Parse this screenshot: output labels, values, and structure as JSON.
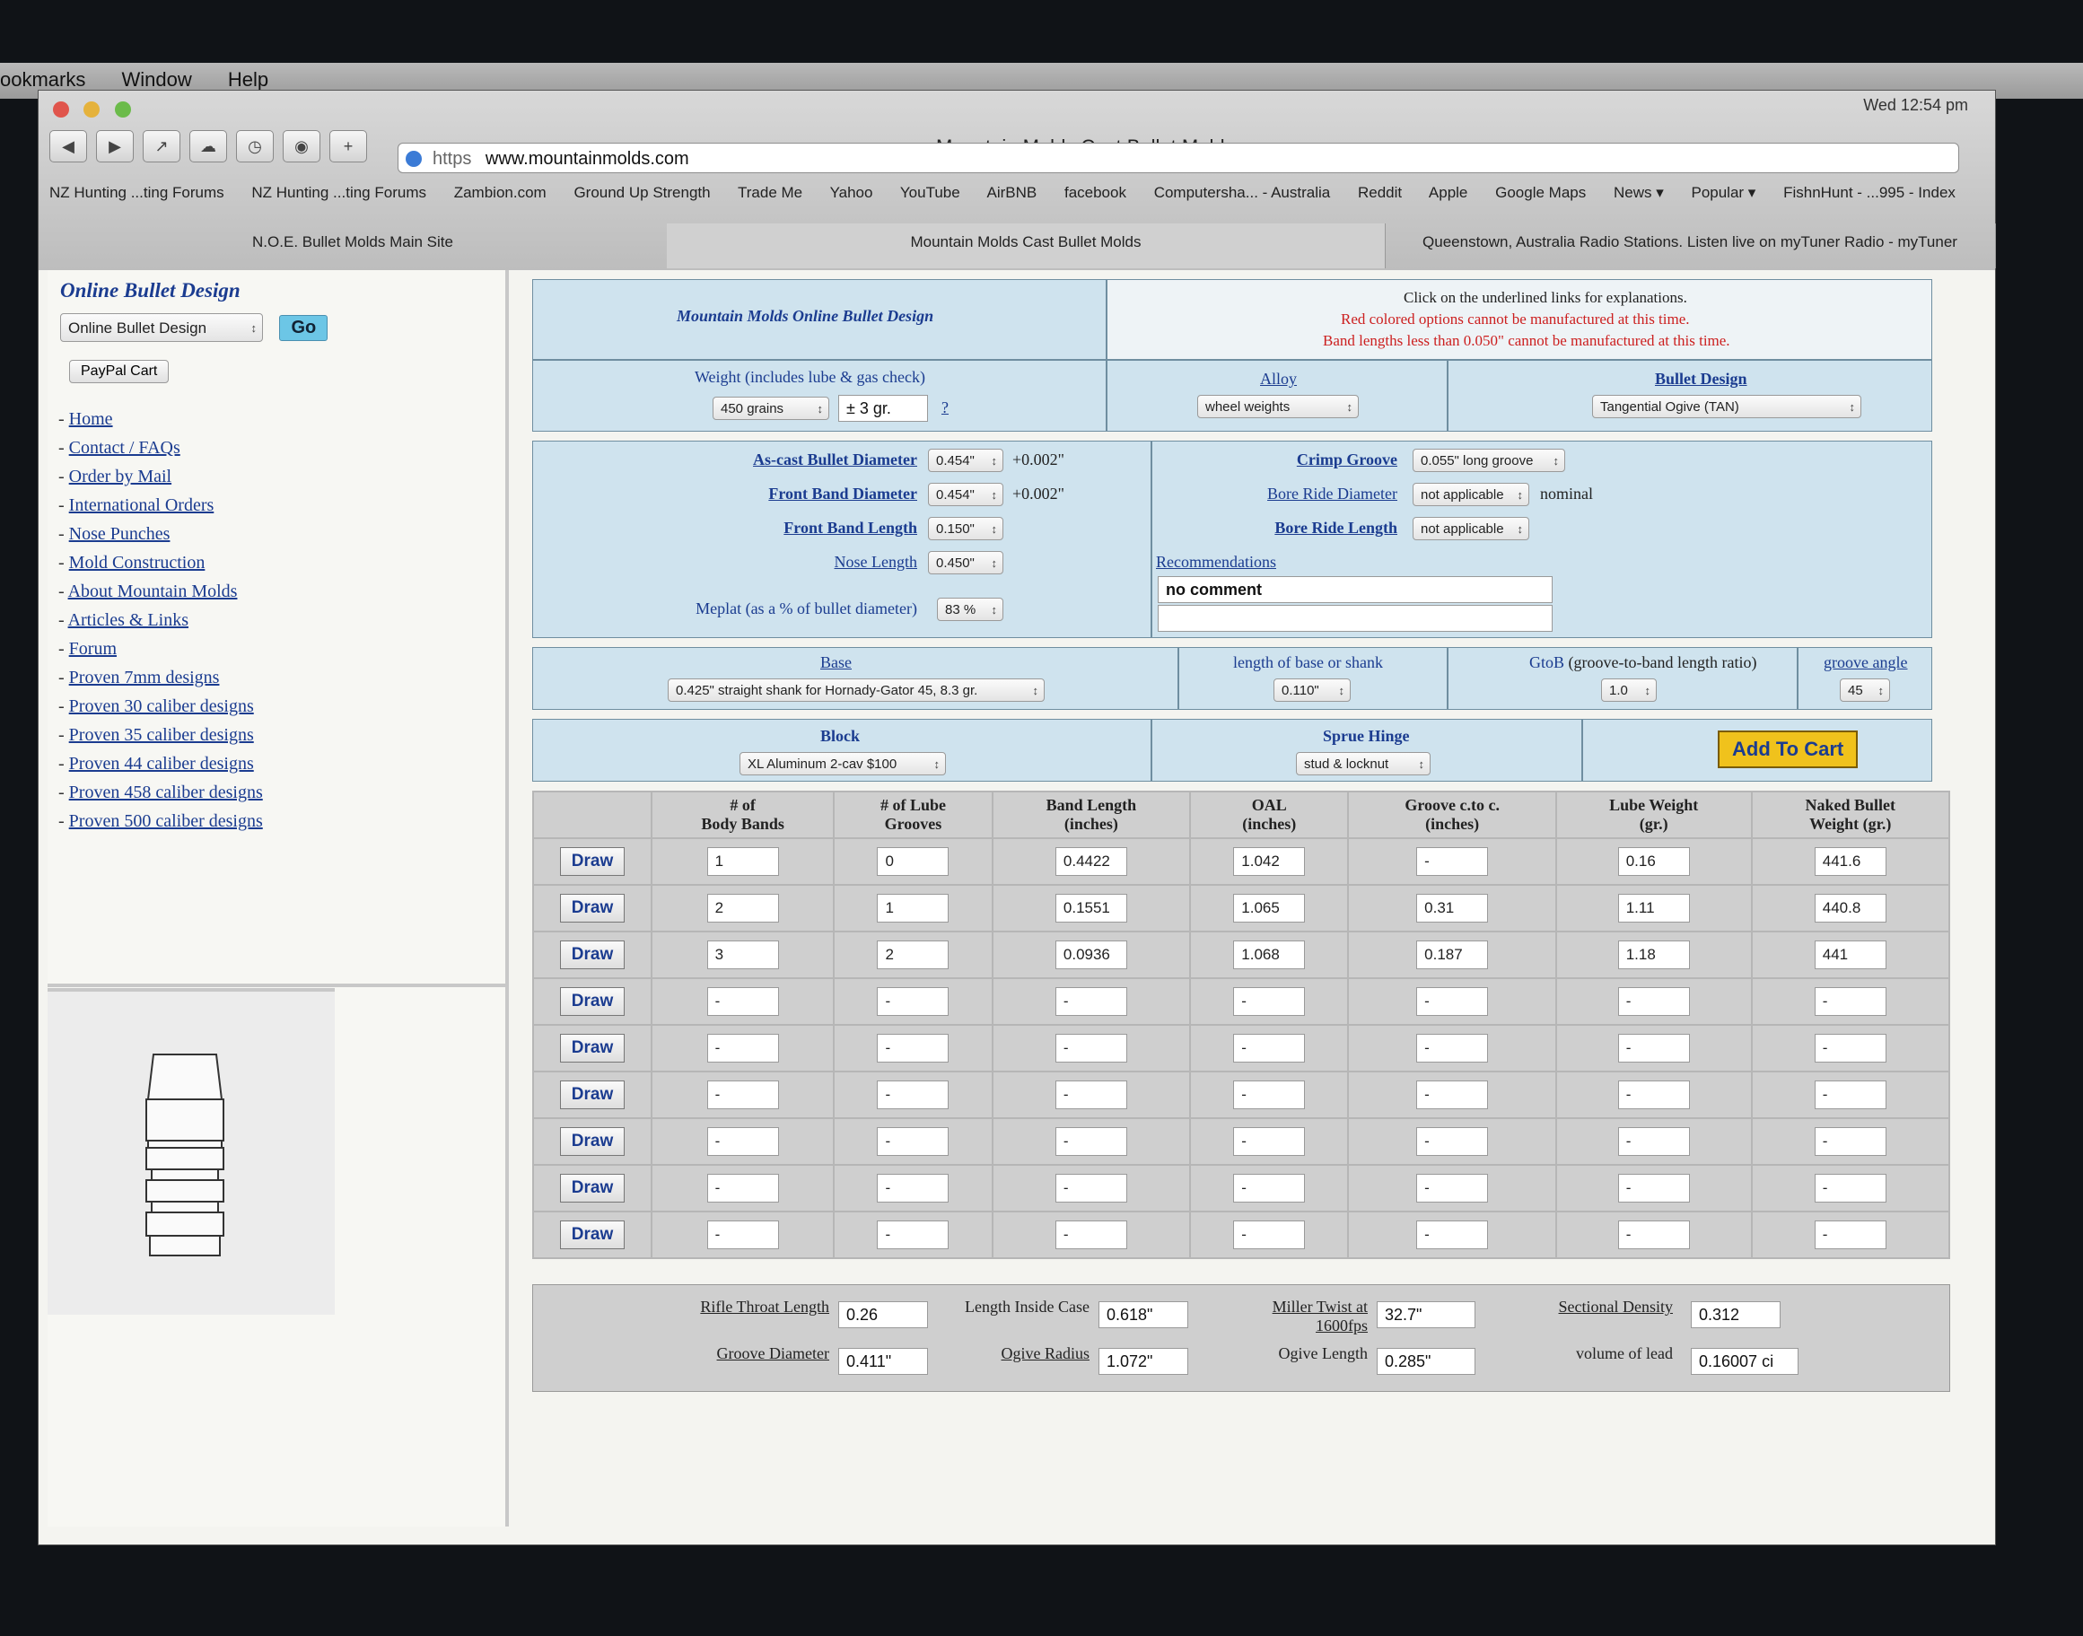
{
  "menubar": {
    "items": [
      "ookmarks",
      "Window",
      "Help"
    ],
    "clock": "Wed 12:54 pm"
  },
  "window": {
    "title": "Mountain Molds Cast Bullet Molds",
    "url_scheme": "https",
    "url": "www.mountainmolds.com",
    "bookmarks": [
      "NZ Hunting ...ting Forums",
      "NZ Hunting ...ting Forums",
      "Zambion.com",
      "Ground Up Strength",
      "Trade Me",
      "Yahoo",
      "YouTube",
      "AirBNB",
      "facebook",
      "Computersha... - Australia",
      "Reddit",
      "Apple",
      "Google Maps",
      "News ▾",
      "Popular ▾",
      "FishnHunt - ...995 - Index"
    ],
    "tabs": [
      "N.O.E. Bullet Molds Main Site",
      "Mountain Molds Cast Bullet Molds",
      "Queenstown, Australia Radio Stations. Listen live on myTuner Radio - myTuner"
    ]
  },
  "sidebar": {
    "title": "Online Bullet Design",
    "select": "Online Bullet Design",
    "go": "Go",
    "paypal": "PayPal Cart",
    "links": [
      "Home",
      "Contact / FAQs",
      "Order by Mail",
      "International Orders",
      "Nose Punches",
      "Mold Construction",
      "About Mountain Molds",
      "Articles & Links",
      "Forum",
      "Proven 7mm designs",
      "Proven 30 caliber designs",
      "Proven 35 caliber designs",
      "Proven 44 caliber designs",
      "Proven 458 caliber designs",
      "Proven 500 caliber designs"
    ]
  },
  "design": {
    "heading": "Mountain Molds Online Bullet Design",
    "info1": "Click on the underlined links for explanations.",
    "info2": "Red colored options cannot be manufactured at this time.",
    "info3": "Band lengths less than 0.050\" cannot be manufactured at this time.",
    "weight_label": "Weight",
    "weight_note": "(includes lube & gas check)",
    "weight": "450 grains",
    "weight_tol": "± 3 gr.",
    "q": "?",
    "alloy_label": "Alloy",
    "alloy": "wheel weights",
    "bullet_design_label": "Bullet Design",
    "bullet_design": "Tangential Ogive (TAN)",
    "ascast_label": "As-cast Bullet Diameter",
    "ascast": "0.454\"",
    "ascast_tol": "+0.002\"",
    "frontband_label": "Front Band Diameter",
    "frontband": "0.454\"",
    "frontband_tol": "+0.002\"",
    "frontlen_label": "Front Band Length",
    "frontlen": "0.150\"",
    "nose_label": "Nose Length",
    "nose": "0.450\"",
    "meplat_label": "Meplat",
    "meplat_note": "(as a % of bullet diameter)",
    "meplat": "83 %",
    "crimp_label": "Crimp Groove",
    "crimp": "0.055\" long groove",
    "boreride_label": "Bore Ride Diameter",
    "boreride": "not applicable",
    "boreride_note": "nominal",
    "borelen_label": "Bore Ride Length",
    "borelen": "not applicable",
    "recs_label": "Recommendations",
    "recs_text": "no comment",
    "base_label": "Base",
    "base": "0.425\" straight shank for Hornady-Gator 45, 8.3 gr.",
    "baselen_label": "length of base or shank",
    "baselen": "0.110\"",
    "gtob_label": "GtoB",
    "gtob_note": "(groove-to-band length ratio)",
    "gtob": "1.0",
    "angle_label": "groove angle",
    "angle": "45",
    "block_label": "Block",
    "block": "XL Aluminum 2-cav $100",
    "sprue_label": "Sprue Hinge",
    "sprue": "stud & locknut",
    "cart": "Add To Cart"
  },
  "table": {
    "headers": [
      "",
      "# of\nBody Bands",
      "# of Lube\nGrooves",
      "Band Length\n(inches)",
      "OAL\n(inches)",
      "Groove c.to c.\n(inches)",
      "Lube Weight\n(gr.)",
      "Naked Bullet\nWeight (gr.)"
    ],
    "draw": "Draw",
    "rows": [
      [
        "1",
        "0",
        "0.4422",
        "1.042",
        "-",
        "0.16",
        "441.6"
      ],
      [
        "2",
        "1",
        "0.1551",
        "1.065",
        "0.31",
        "1.11",
        "440.8"
      ],
      [
        "3",
        "2",
        "0.0936",
        "1.068",
        "0.187",
        "1.18",
        "441"
      ],
      [
        "-",
        "-",
        "-",
        "-",
        "-",
        "-",
        "-"
      ],
      [
        "-",
        "-",
        "-",
        "-",
        "-",
        "-",
        "-"
      ],
      [
        "-",
        "-",
        "-",
        "-",
        "-",
        "-",
        "-"
      ],
      [
        "-",
        "-",
        "-",
        "-",
        "-",
        "-",
        "-"
      ],
      [
        "-",
        "-",
        "-",
        "-",
        "-",
        "-",
        "-"
      ],
      [
        "-",
        "-",
        "-",
        "-",
        "-",
        "-",
        "-"
      ]
    ]
  },
  "summary": {
    "throat_label": "Rifle Throat Length",
    "throat": "0.26",
    "inside_label": "Length Inside Case",
    "inside": "0.618\"",
    "miller_label": "Miller Twist at 1600fps",
    "miller": "32.7\"",
    "sd_label": "Sectional Density",
    "sd": "0.312",
    "groove_label": "Groove Diameter",
    "groove": "0.411\"",
    "ogive_label": "Ogive Radius",
    "ogive": "1.072\"",
    "ogivelen_label": "Ogive Length",
    "ogivelen": "0.285\"",
    "vol_label": "volume of lead",
    "vol": "0.16007 ci"
  }
}
